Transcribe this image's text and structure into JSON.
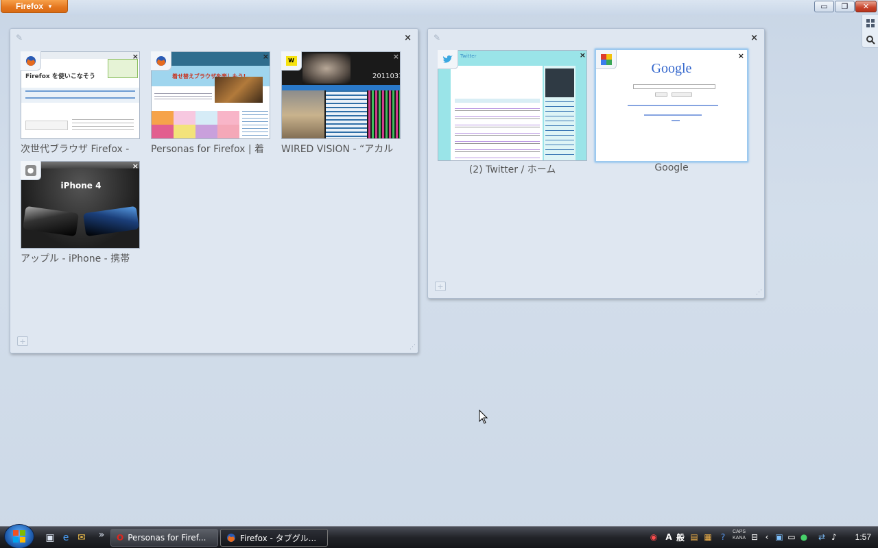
{
  "app": {
    "menu_button": "Firefox"
  },
  "window_controls": {
    "minimize": "▭",
    "restore": "❐",
    "close": "✕"
  },
  "groups": [
    {
      "tabs": [
        {
          "title": "次世代ブラウザ Firefox - ",
          "thumb_heading": "Firefox を使いこなそう"
        },
        {
          "title": "Personas for Firefox | 着",
          "thumb_heading": "着せ替えブラウザを楽しもう!"
        },
        {
          "title": "WIRED VISION - “アカル",
          "thumb_heading": "2011031"
        },
        {
          "title": "アップル - iPhone - 携帯",
          "thumb_heading": "iPhone 4"
        }
      ]
    },
    {
      "tabs": [
        {
          "title": "(2) Twitter / ホーム",
          "thumb_heading": "Twitter"
        },
        {
          "title": "Google",
          "thumb_heading": "Google"
        }
      ]
    }
  ],
  "taskbar": {
    "buttons": [
      {
        "label": "Personas for Firef..."
      },
      {
        "label": "Firefox - タブグル..."
      }
    ],
    "chevron": "»",
    "caps_label": "CAPS",
    "kana_label": "KANA",
    "ime_label": "般",
    "ime_mode": "A",
    "clock": "1:57"
  },
  "colors": {
    "firefox_orange": "#e4761e",
    "twitter_sky": "#9ae4e8",
    "google_blue": "#3366cc"
  }
}
